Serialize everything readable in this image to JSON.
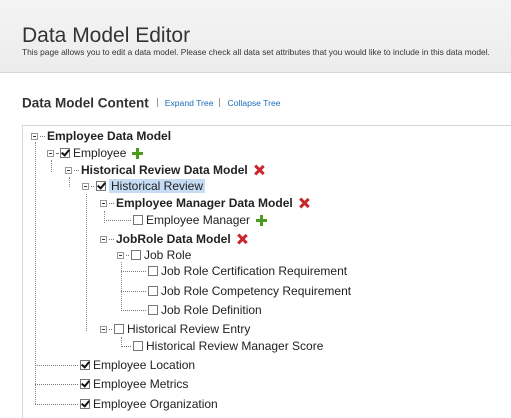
{
  "header": {
    "title": "Data Model Editor",
    "description": "This page allows you to edit a data model. Please check all data set attributes that you would like to include in this data model."
  },
  "section": {
    "title": "Data Model Content",
    "expand_label": "Expand Tree",
    "collapse_label": "Collapse Tree"
  },
  "tree": {
    "root": "Employee Data Model",
    "employee": "Employee",
    "historical_review_model": "Historical Review Data Model",
    "historical_review": "Historical Review",
    "employee_manager_model": "Employee Manager Data Model",
    "employee_manager": "Employee Manager",
    "jobrole_model": "JobRole Data Model",
    "job_role": "Job Role",
    "job_role_cert": "Job Role Certification Requirement",
    "job_role_comp": "Job Role Competency Requirement",
    "job_role_def": "Job Role Definition",
    "hist_review_entry": "Historical Review Entry",
    "hist_review_mgr_score": "Historical Review Manager Score",
    "employee_location": "Employee Location",
    "employee_metrics": "Employee Metrics",
    "employee_organization": "Employee Organization"
  },
  "checked": {
    "employee": true,
    "historical_review": true,
    "employee_manager": false,
    "job_role": false,
    "job_role_cert": false,
    "job_role_comp": false,
    "job_role_def": false,
    "hist_review_entry": false,
    "hist_review_mgr_score": false,
    "employee_location": true,
    "employee_metrics": true,
    "employee_organization": true
  },
  "icons": {
    "add": "plus-icon",
    "remove": "x-icon",
    "add_color": "#4a9b1e",
    "remove_color": "#c8252c",
    "link_color": "#1a6ebd",
    "selection_color": "#c6dcf4"
  }
}
